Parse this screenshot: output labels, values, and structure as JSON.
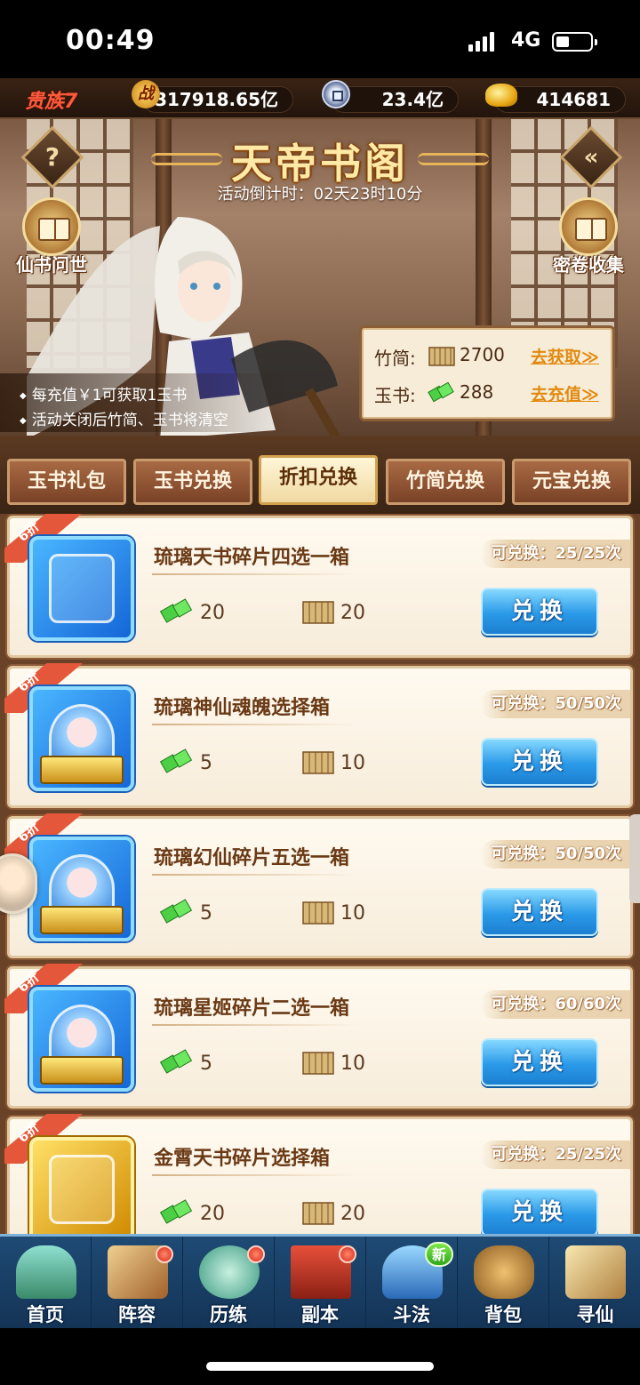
{
  "status_bar": {
    "time": "00:49",
    "network": "4G"
  },
  "resources": {
    "vip": "贵族7",
    "power_icon_text": "战",
    "power": "317918.65亿",
    "coins": "23.4亿",
    "gold": "414681"
  },
  "banner": {
    "title": "天帝书阁",
    "countdown": "活动倒计时：02天23时10分",
    "help": "?",
    "left_button": "仙书问世",
    "right_button": "密卷收集",
    "notes": [
      "每充值￥1可获取1玉书",
      "活动关闭后竹简、玉书将清空"
    ],
    "currency": [
      {
        "label": "竹简:",
        "value": "2700",
        "action": "去获取≫"
      },
      {
        "label": "玉书:",
        "value": "288",
        "action": "去充值≫"
      }
    ]
  },
  "tabs": [
    "玉书礼包",
    "玉书兑换",
    "折扣兑换",
    "竹简兑换",
    "元宝兑换"
  ],
  "active_tab": "折扣兑换",
  "items": [
    {
      "discount": "6折",
      "name": "琉璃天书碎片四选一箱",
      "limit": "可兑换：25/25次",
      "cost_jade": "20",
      "cost_bamboo": "20",
      "button": "兑换"
    },
    {
      "discount": "6折",
      "name": "琉璃神仙魂魄选择箱",
      "limit": "可兑换：50/50次",
      "cost_jade": "5",
      "cost_bamboo": "10",
      "button": "兑换"
    },
    {
      "discount": "6折",
      "name": "琉璃幻仙碎片五选一箱",
      "limit": "可兑换：50/50次",
      "cost_jade": "5",
      "cost_bamboo": "10",
      "button": "兑换"
    },
    {
      "discount": "6折",
      "name": "琉璃星姬碎片二选一箱",
      "limit": "可兑换：60/60次",
      "cost_jade": "5",
      "cost_bamboo": "10",
      "button": "兑换"
    },
    {
      "discount": "6折",
      "name": "金霄天书碎片选择箱",
      "limit": "可兑换：25/25次",
      "cost_jade": "20",
      "cost_bamboo": "20",
      "button": "兑换"
    }
  ],
  "bottom_nav": [
    {
      "label": "首页"
    },
    {
      "label": "阵容"
    },
    {
      "label": "历练"
    },
    {
      "label": "副本"
    },
    {
      "label": "斗法",
      "badge": "新"
    },
    {
      "label": "背包"
    },
    {
      "label": "寻仙"
    }
  ],
  "colors": {
    "accent_blue": "#2a9ae8",
    "discount_red": "#e5573a",
    "jade_green": "#3fbf3a",
    "bamboo_tan": "#c8a46a"
  }
}
